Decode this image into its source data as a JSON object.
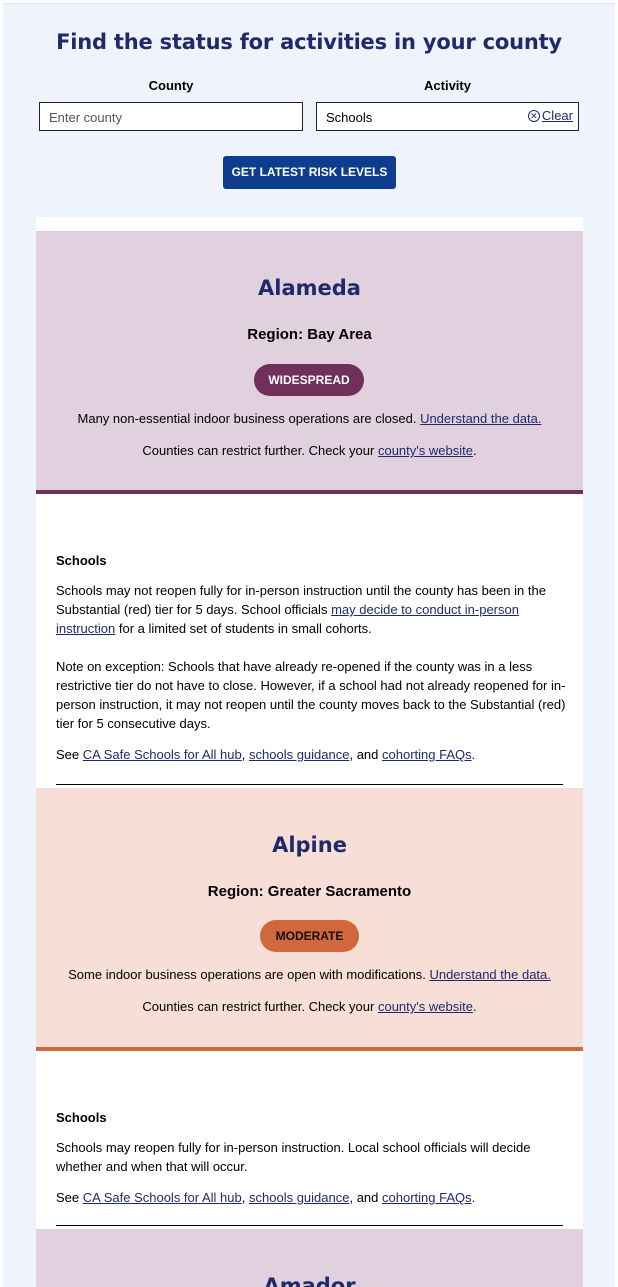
{
  "header": {
    "title": "Find the status for activities in your county",
    "county_label": "County",
    "activity_label": "Activity",
    "county_placeholder": "Enter county",
    "activity_value": "Schools",
    "clear_label": "Clear",
    "submit_label": "GET LATEST RISK LEVELS"
  },
  "counties": [
    {
      "name": "Alameda",
      "region": "Region: Bay Area",
      "tier": "WIDESPREAD",
      "tier_color": "#70305a",
      "bg_color": "#e1d1de",
      "tier_text": "Many non-essential indoor business operations are closed.",
      "understand_link": "Understand the data.",
      "restrict_text": "Counties can restrict further. Check your",
      "county_site_link": "county's website",
      "activity_heading": "Schools",
      "p1_a": "Schools may not reopen fully for in-person instruction until the county has been in the Substantial (red) tier for 5 days. School officials",
      "p1_link": "may decide to conduct in-person instruction",
      "p1_b": "for a limited set of students in small cohorts.",
      "p2": "Note on exception: Schools that have already re-opened if the county was in a less restrictive tier do not have to close. However, if a school had not already reopened for in-person instruction, it may not reopen until the county moves back to the Substantial (red) tier for 5 consecutive days.",
      "see": "See",
      "link_hub": "CA Safe Schools for All hub",
      "link_guidance": "schools guidance",
      "and": ", and",
      "link_faq": "cohorting FAQs"
    },
    {
      "name": "Alpine",
      "region": "Region: Greater Sacramento",
      "tier": "MODERATE",
      "tier_color": "#d0673d",
      "bg_color": "#f7ded6",
      "tier_text": "Some indoor business operations are open with modifications.",
      "understand_link": "Understand the data.",
      "restrict_text": "Counties can restrict further. Check your",
      "county_site_link": "county's website",
      "activity_heading": "Schools",
      "p1": "Schools may reopen fully for in-person instruction. Local school officials will decide whether and when that will occur.",
      "see": "See",
      "link_hub": "CA Safe Schools for All hub",
      "link_guidance": "schools guidance",
      "and": ", and",
      "link_faq": "cohorting FAQs"
    },
    {
      "name": "Amador",
      "bg_color": "#e1d1de"
    }
  ]
}
